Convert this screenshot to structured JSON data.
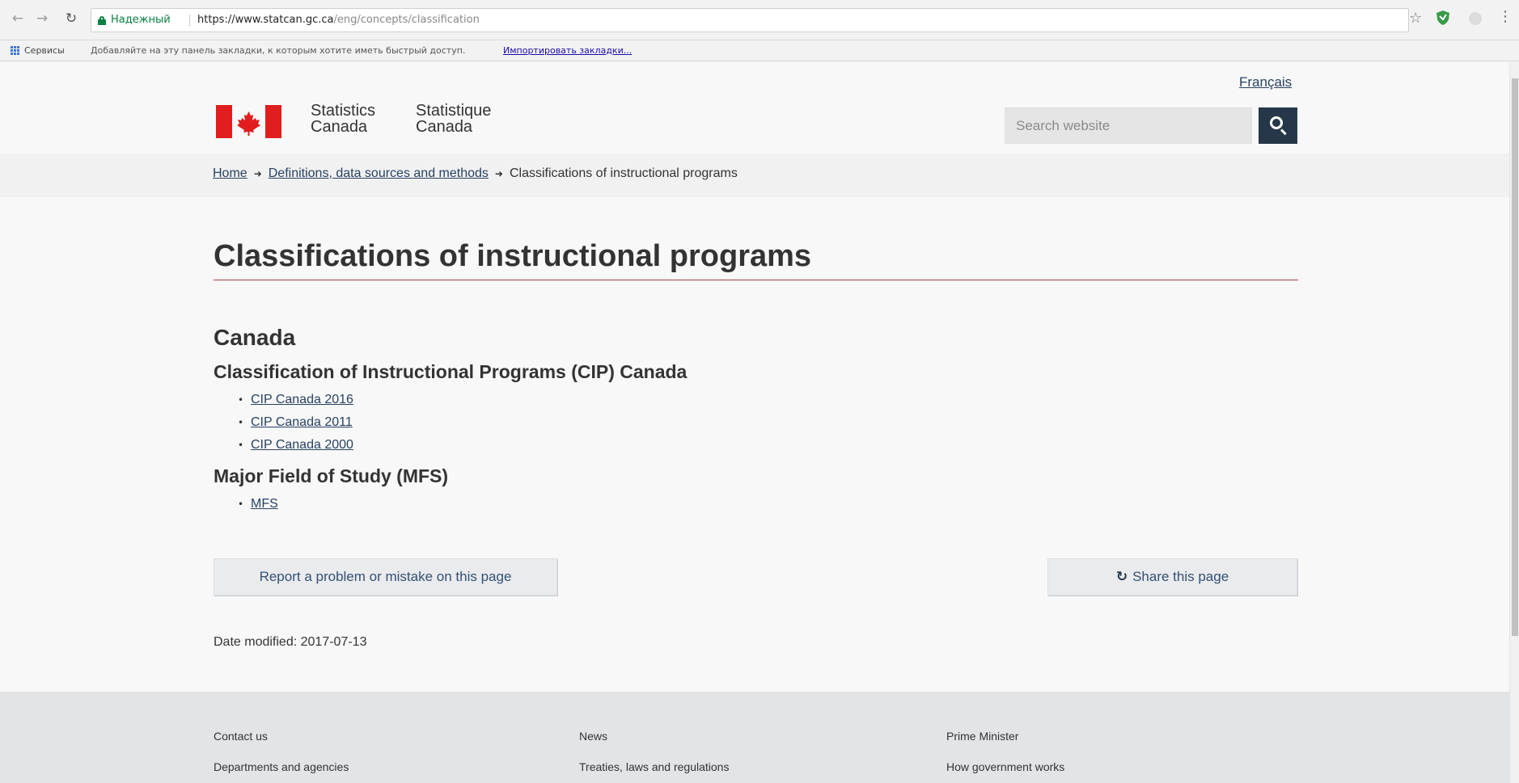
{
  "browser": {
    "secure_label": "Надежный",
    "url_host": "https://www.statcan.gc.ca",
    "url_path": "/eng/concepts/classification",
    "icons": [
      "back-arrow-icon",
      "forward-arrow-icon",
      "reload-icon",
      "lock-icon",
      "star-icon",
      "shield-icon",
      "extension-icon",
      "menu-icon"
    ]
  },
  "bookmarks": {
    "apps_label": "Сервисы",
    "hint": "Добавляйте на эту панель закладки, к которым хотите иметь быстрый доступ.",
    "import_link": "Импортировать закладки..."
  },
  "header": {
    "language_link": "Français",
    "signature_en_line1": "Statistics",
    "signature_en_line2": "Canada",
    "signature_fr_line1": "Statistique",
    "signature_fr_line2": "Canada",
    "search_placeholder": "Search website",
    "brand_color": "#26374a",
    "flag_red": "#e01e1e"
  },
  "breadcrumb": {
    "items": [
      {
        "label": "Home",
        "link": true
      },
      {
        "label": "Definitions, data sources and methods",
        "link": true
      },
      {
        "label": "Classifications of instructional programs",
        "link": false
      }
    ]
  },
  "main": {
    "title": "Classifications of instructional programs",
    "rule_color": "#af3c43",
    "section_canada": "Canada",
    "cip_heading": "Classification of Instructional Programs (CIP) Canada",
    "cip_links": [
      "CIP Canada 2016",
      "CIP Canada 2011",
      "CIP Canada 2000"
    ],
    "mfs_heading": "Major Field of Study (MFS)",
    "mfs_links": [
      "MFS"
    ],
    "report_button": "Report a problem or mistake on this page",
    "share_button": "Share this page",
    "date_modified_label": "Date modified:",
    "date_modified_value": "2017-07-13"
  },
  "footer": {
    "links": [
      "Contact us",
      "Departments and agencies",
      "News",
      "Treaties, laws and regulations",
      "Prime Minister",
      "How government works"
    ]
  }
}
